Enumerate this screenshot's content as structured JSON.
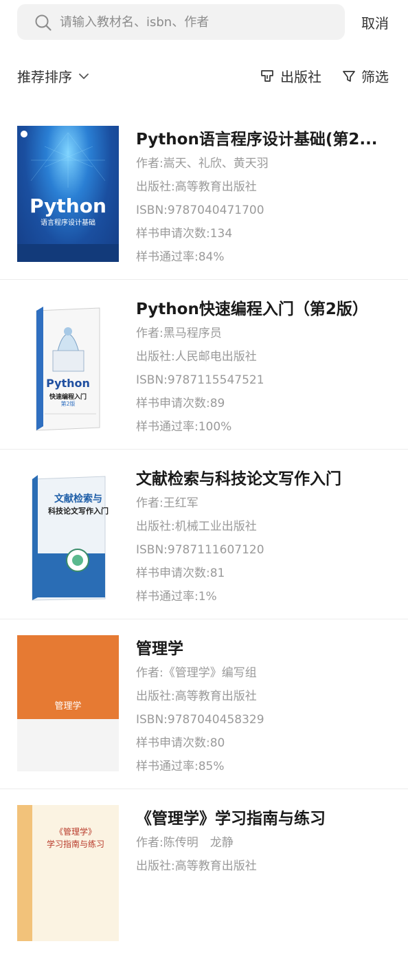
{
  "search": {
    "placeholder": "请输入教材名、isbn、作者",
    "cancel_label": "取消"
  },
  "filters": {
    "sort_label": "推荐排序",
    "publisher_label": "出版社",
    "filter_label": "筛选"
  },
  "books": [
    {
      "title": "Python语言程序设计基础(第2...",
      "author": "作者:嵩天、礼欣、黄天羽",
      "publisher": "出版社:高等教育出版社",
      "isbn": "ISBN:9787040471700",
      "applications": "样书申请次数:134",
      "pass_rate": "样书通过率:84%",
      "cover_text": "Python",
      "cover_subtitle": "语言程序设计基础"
    },
    {
      "title": "Python快速编程入门（第2版）",
      "author": "作者:黑马程序员",
      "publisher": "出版社:人民邮电出版社",
      "isbn": "ISBN:9787115547521",
      "applications": "样书申请次数:89",
      "pass_rate": "样书通过率:100%",
      "cover_text": "Python",
      "cover_subtitle": "快速编程入门",
      "cover_edition": "第2版"
    },
    {
      "title": "文献检索与科技论文写作入门",
      "author": "作者:王红军",
      "publisher": "出版社:机械工业出版社",
      "isbn": "ISBN:9787111607120",
      "applications": "样书申请次数:81",
      "pass_rate": "样书通过率:1%",
      "cover_text": "文献检索与",
      "cover_subtitle": "科技论文写作入门"
    },
    {
      "title": "管理学",
      "author": "作者:《管理学》编写组",
      "publisher": "出版社:高等教育出版社",
      "isbn": "ISBN:9787040458329",
      "applications": "样书申请次数:80",
      "pass_rate": "样书通过率:85%",
      "cover_text": "管理学"
    },
    {
      "title": "《管理学》学习指南与练习",
      "author": "作者:陈传明　龙静",
      "publisher": "出版社:高等教育出版社",
      "cover_text": "《管理学》",
      "cover_subtitle": "学习指南与练习"
    }
  ]
}
